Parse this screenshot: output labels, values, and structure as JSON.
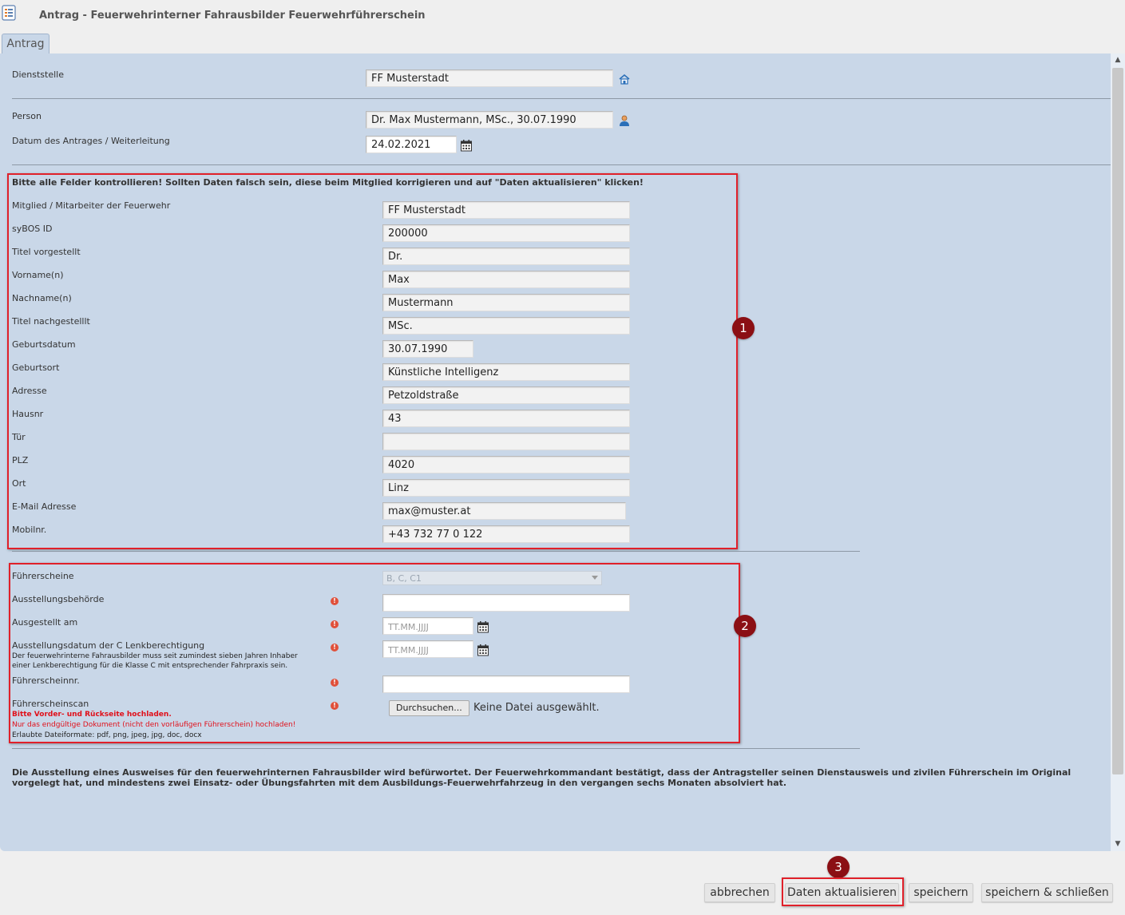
{
  "window": {
    "title": "Antrag - Feuerwehrinterner Fahrausbilder Feuerwehrführerschein",
    "app_icon": "form-list-icon"
  },
  "tabs": [
    {
      "label": "Antrag"
    }
  ],
  "header_fields": {
    "dienststelle": {
      "label": "Dienststelle",
      "value": "FF Musterstadt",
      "icon": "station-house-icon"
    },
    "person": {
      "label": "Person",
      "value": "Dr. Max Mustermann, MSc., 30.07.1990",
      "icon": "person-icon"
    },
    "datum": {
      "label": "Datum des Antrages / Weiterleitung",
      "value": "24.02.2021",
      "icon": "calendar-icon"
    }
  },
  "section1": {
    "notice": "Bitte alle Felder kontrollieren! Sollten Daten falsch sein, diese beim Mitglied korrigieren und auf \"Daten aktualisieren\" klicken!",
    "marker": "1",
    "fields": [
      {
        "label": "Mitglied / Mitarbeiter der Feuerwehr",
        "value": "FF Musterstadt"
      },
      {
        "label": "syBOS ID",
        "value": "200000"
      },
      {
        "label": "Titel vorgestellt",
        "value": "Dr."
      },
      {
        "label": "Vorname(n)",
        "value": "Max"
      },
      {
        "label": "Nachname(n)",
        "value": "Mustermann"
      },
      {
        "label": "Titel nachgestelllt",
        "value": "MSc."
      },
      {
        "label": "Geburtsdatum",
        "value": "30.07.1990"
      },
      {
        "label": "Geburtsort",
        "value": "Künstliche Intelligenz"
      },
      {
        "label": "Adresse",
        "value": "Petzoldstraße"
      },
      {
        "label": "Hausnr",
        "value": "43"
      },
      {
        "label": "Tür",
        "value": ""
      },
      {
        "label": "PLZ",
        "value": "4020"
      },
      {
        "label": "Ort",
        "value": "Linz"
      },
      {
        "label": "E-Mail Adresse",
        "value": "max@muster.at"
      },
      {
        "label": "Mobilnr.",
        "value": "+43 732 77 0 122"
      }
    ]
  },
  "section2": {
    "marker": "2",
    "fuehrerscheine": {
      "label": "Führerscheine",
      "value": "B, C, C1"
    },
    "ausstellungsbehoerde": {
      "label": "Ausstellungsbehörde",
      "value": ""
    },
    "ausgestellt_am": {
      "label": "Ausgestellt am",
      "placeholder": "TT.MM.JJJJ"
    },
    "c_datum": {
      "label": "Ausstellungsdatum der C Lenkberechtigung",
      "note_line1": "Der feuerwehrinterne Fahrausbilder muss seit zumindest sieben Jahren Inhaber",
      "note_line2": "einer Lenkberechtigung für die Klasse C mit entsprechender Fahrpraxis sein.",
      "placeholder": "TT.MM.JJJJ"
    },
    "fuehrerscheinnr": {
      "label": "Führerscheinnr.",
      "value": ""
    },
    "scan": {
      "label": "Führerscheinscan",
      "note_red1": "Bitte Vorder- und Rückseite hochladen.",
      "note_red2": "Nur das endgültige Dokument (nicht den vorläufigen Führerschein) hochladen!",
      "note_formats": "Erlaubte Dateiformate: pdf, png, jpeg, jpg, doc, docx",
      "browse_label": "Durchsuchen...",
      "no_file_text": "Keine Datei ausgewählt."
    },
    "required_mark": "!"
  },
  "footer_text": "Die Ausstellung eines Ausweises für den feuerwehrinternen Fahrausbilder wird befürwortet. Der Feuerwehrkommandant bestätigt, dass der Antragsteller seinen Dienstausweis und zivilen Führerschein im Original vorgelegt hat, und mindestens zwei Einsatz- oder Übungsfahrten mit dem Ausbildungs-Feuerwehrfahrzeug in den vergangen sechs Monaten absolviert hat.",
  "buttons": {
    "abbrechen": "abbrechen",
    "aktualisieren": "Daten aktualisieren",
    "speichern": "speichern",
    "speichern_schliessen": "speichern & schließen",
    "marker": "3"
  },
  "colors": {
    "highlight": "#e0202a",
    "marker": "#8b0f14",
    "panel": "#c9d7e8"
  }
}
